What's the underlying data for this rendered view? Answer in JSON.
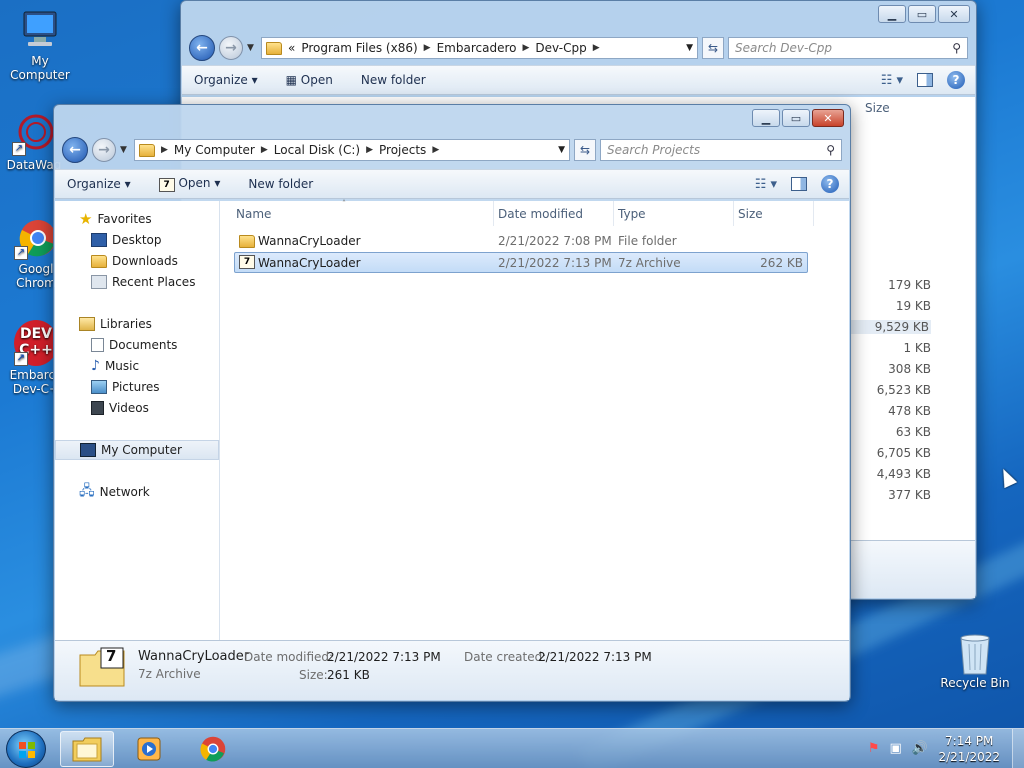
{
  "desktop": {
    "icons": [
      {
        "label": "My Computer"
      },
      {
        "label": "DataWag"
      },
      {
        "label1": "Googl",
        "label2": "Chrom"
      },
      {
        "label1": "Embarca",
        "label2": "Dev-C+"
      },
      {
        "label": "Recycle Bin"
      }
    ],
    "dev_icon_text": "DEV",
    "dev_icon_text2": "C++"
  },
  "back_window": {
    "breadcrumb_prefix": "«",
    "breadcrumbs": [
      "Program Files (x86)",
      "Embarcadero",
      "Dev-Cpp"
    ],
    "search_placeholder": "Search Dev-Cpp",
    "toolbar": {
      "organize": "Organize",
      "open": "Open",
      "new_folder": "New folder"
    },
    "size_header": "Size",
    "sizes": [
      "179 KB",
      "19 KB",
      "9,529 KB",
      "1 KB",
      "308 KB",
      "6,523 KB",
      "478 KB",
      "63 KB",
      "6,705 KB",
      "4,493 KB",
      "377 KB"
    ]
  },
  "front_window": {
    "breadcrumbs": [
      "My Computer",
      "Local Disk (C:)",
      "Projects"
    ],
    "search_placeholder": "Search Projects",
    "toolbar": {
      "organize": "Organize",
      "open": "Open",
      "new_folder": "New folder"
    },
    "nav": {
      "favorites": "Favorites",
      "desktop": "Desktop",
      "downloads": "Downloads",
      "recent": "Recent Places",
      "libraries": "Libraries",
      "documents": "Documents",
      "music": "Music",
      "pictures": "Pictures",
      "videos": "Videos",
      "computer": "My Computer",
      "network": "Network"
    },
    "columns": {
      "name": "Name",
      "date": "Date modified",
      "type": "Type",
      "size": "Size"
    },
    "files": [
      {
        "name": "WannaCryLoader",
        "date": "2/21/2022 7:08 PM",
        "type": "File folder",
        "size": ""
      },
      {
        "name": "WannaCryLoader",
        "date": "2/21/2022 7:13 PM",
        "type": "7z Archive",
        "size": "262 KB"
      }
    ],
    "details": {
      "name": "WannaCryLoader",
      "type": "7z Archive",
      "modified_label": "Date modified:",
      "modified_value": "2/21/2022 7:13 PM",
      "created_label": "Date created:",
      "created_value": "2/21/2022 7:13 PM",
      "size_label": "Size:",
      "size_value": "261 KB"
    }
  },
  "taskbar": {
    "time": "7:14 PM",
    "date": "2/21/2022"
  },
  "archive_glyph": "7"
}
